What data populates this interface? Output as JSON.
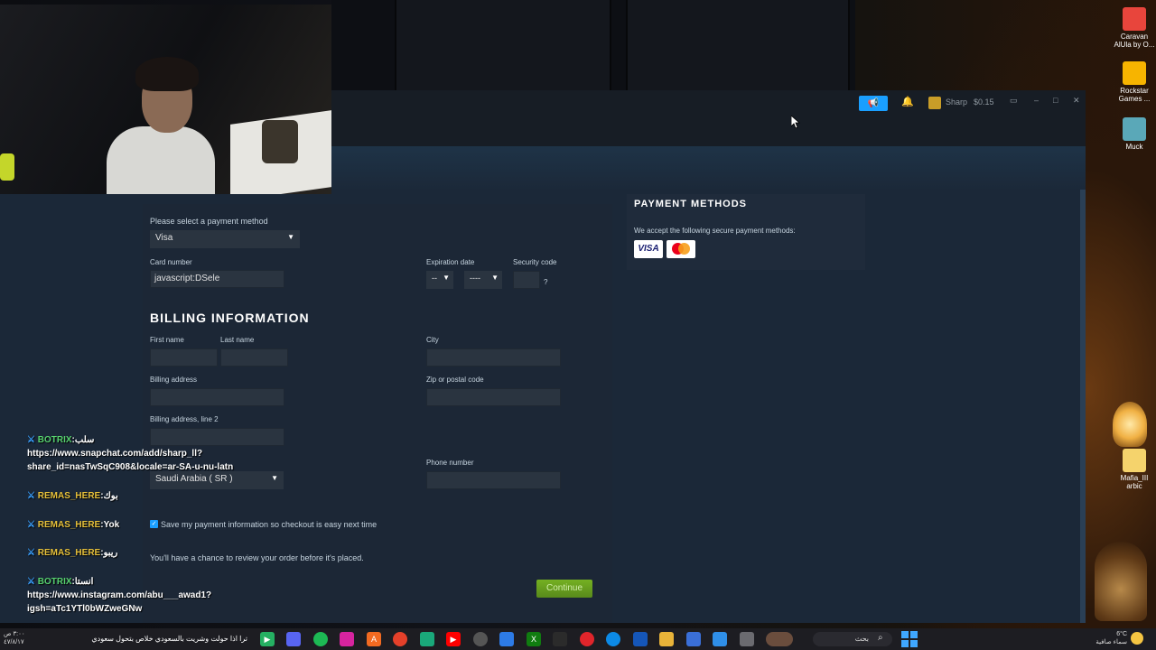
{
  "steam": {
    "titlebar": {
      "announcement_icon": "megaphone-icon",
      "username": "Sharp",
      "wallet": "$0.15"
    },
    "checkout": {
      "payment_method_label": "Please select a payment method",
      "payment_method_value": "Visa",
      "card_number_label": "Card number",
      "card_number_value": "javascript:DSele",
      "expiration_label": "Expiration date",
      "expiration_month": "--",
      "expiration_year": "----",
      "security_code_label": "Security code",
      "security_help": "?",
      "billing_heading": "BILLING INFORMATION",
      "first_name_label": "First name",
      "last_name_label": "Last name",
      "city_label": "City",
      "billing_address_label": "Billing address",
      "zip_label": "Zip or postal code",
      "billing_address2_label": "Billing address, line 2",
      "country_value": "Saudi Arabia ( SR )",
      "phone_label": "Phone number",
      "save_info_label": "Save my payment information so checkout is easy next time",
      "review_note": "You'll have a chance to review your order before it's placed.",
      "continue_label": "Continue"
    },
    "payment_methods": {
      "title": "PAYMENT METHODS",
      "text": "We accept the following secure payment methods:",
      "visa": "VISA"
    }
  },
  "desktop_icons": [
    {
      "label": "Caravan AlUla by O...",
      "icon": "pdf-icon",
      "color": "#e8453c"
    },
    {
      "label": "Rockstar Games ...",
      "icon": "rockstar-icon",
      "color": "#f7b400"
    },
    {
      "label": "Muck",
      "icon": "muck-icon",
      "color": "#5aa8b8"
    },
    {
      "label": "Mafia_III arbic",
      "icon": "folder-icon",
      "color": "#f5d36c"
    }
  ],
  "chat": [
    {
      "name": "BOTRIX",
      "text": "سلب",
      "continuation": [
        "https://www.snapchat.com/add/sharp_ll?",
        "share_id=nasTwSqC908&locale=ar-SA-u-nu-latn"
      ]
    },
    {
      "name": "REMAS_HERE",
      "text": "بوك"
    },
    {
      "name": "REMAS_HERE",
      "text": "Yok"
    },
    {
      "name": "REMAS_HERE",
      "text": "ريبو"
    },
    {
      "name": "BOTRIX",
      "text": "انستا",
      "continuation": [
        "https://www.instagram.com/abu___awad1?",
        "igsh=aTc1YTl0bWZweGNw"
      ]
    }
  ],
  "taskbar": {
    "search_placeholder": "بحث",
    "ticker_text": "ترا اذا حولت وشريت بالسعودي خلاص بتحول سعودي",
    "time": "٣:٠٠ ص",
    "date": "٤٧/٨/١٧",
    "weather_temp": "6°C",
    "weather_text": "سماء صافية"
  }
}
